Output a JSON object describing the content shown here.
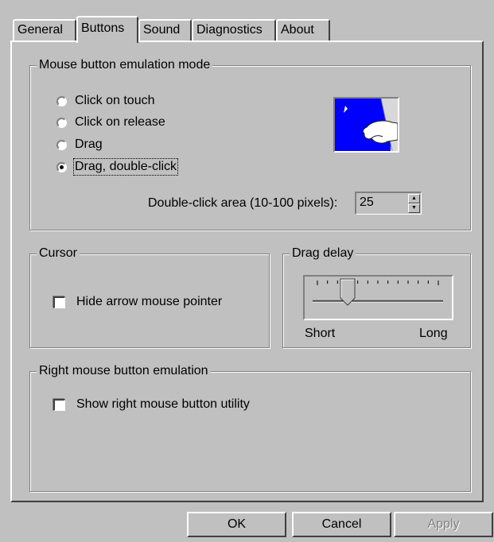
{
  "tabs": [
    "General",
    "Buttons",
    "Sound",
    "Diagnostics",
    "About"
  ],
  "emulation": {
    "title": "Mouse button emulation mode",
    "options": [
      "Click on touch",
      "Click on release",
      "Drag",
      "Drag, double-click"
    ],
    "selected_index": 3,
    "double_click_label": "Double-click area (10-100 pixels):",
    "double_click_value": "25"
  },
  "cursor": {
    "title": "Cursor",
    "hide_pointer_label": "Hide arrow mouse pointer",
    "hide_pointer_checked": false
  },
  "drag_delay": {
    "title": "Drag delay",
    "min_label": "Short",
    "max_label": "Long",
    "ticks": 13,
    "value": 0.25
  },
  "right_button": {
    "title": "Right mouse button emulation",
    "utility_label": "Show right mouse button utility",
    "utility_checked": false
  },
  "buttons": {
    "ok": "OK",
    "cancel": "Cancel",
    "apply": "Apply"
  },
  "colors": {
    "face": "#c0c0c0",
    "picture_blue": "#0000ff",
    "disabled_text": "#808080"
  }
}
